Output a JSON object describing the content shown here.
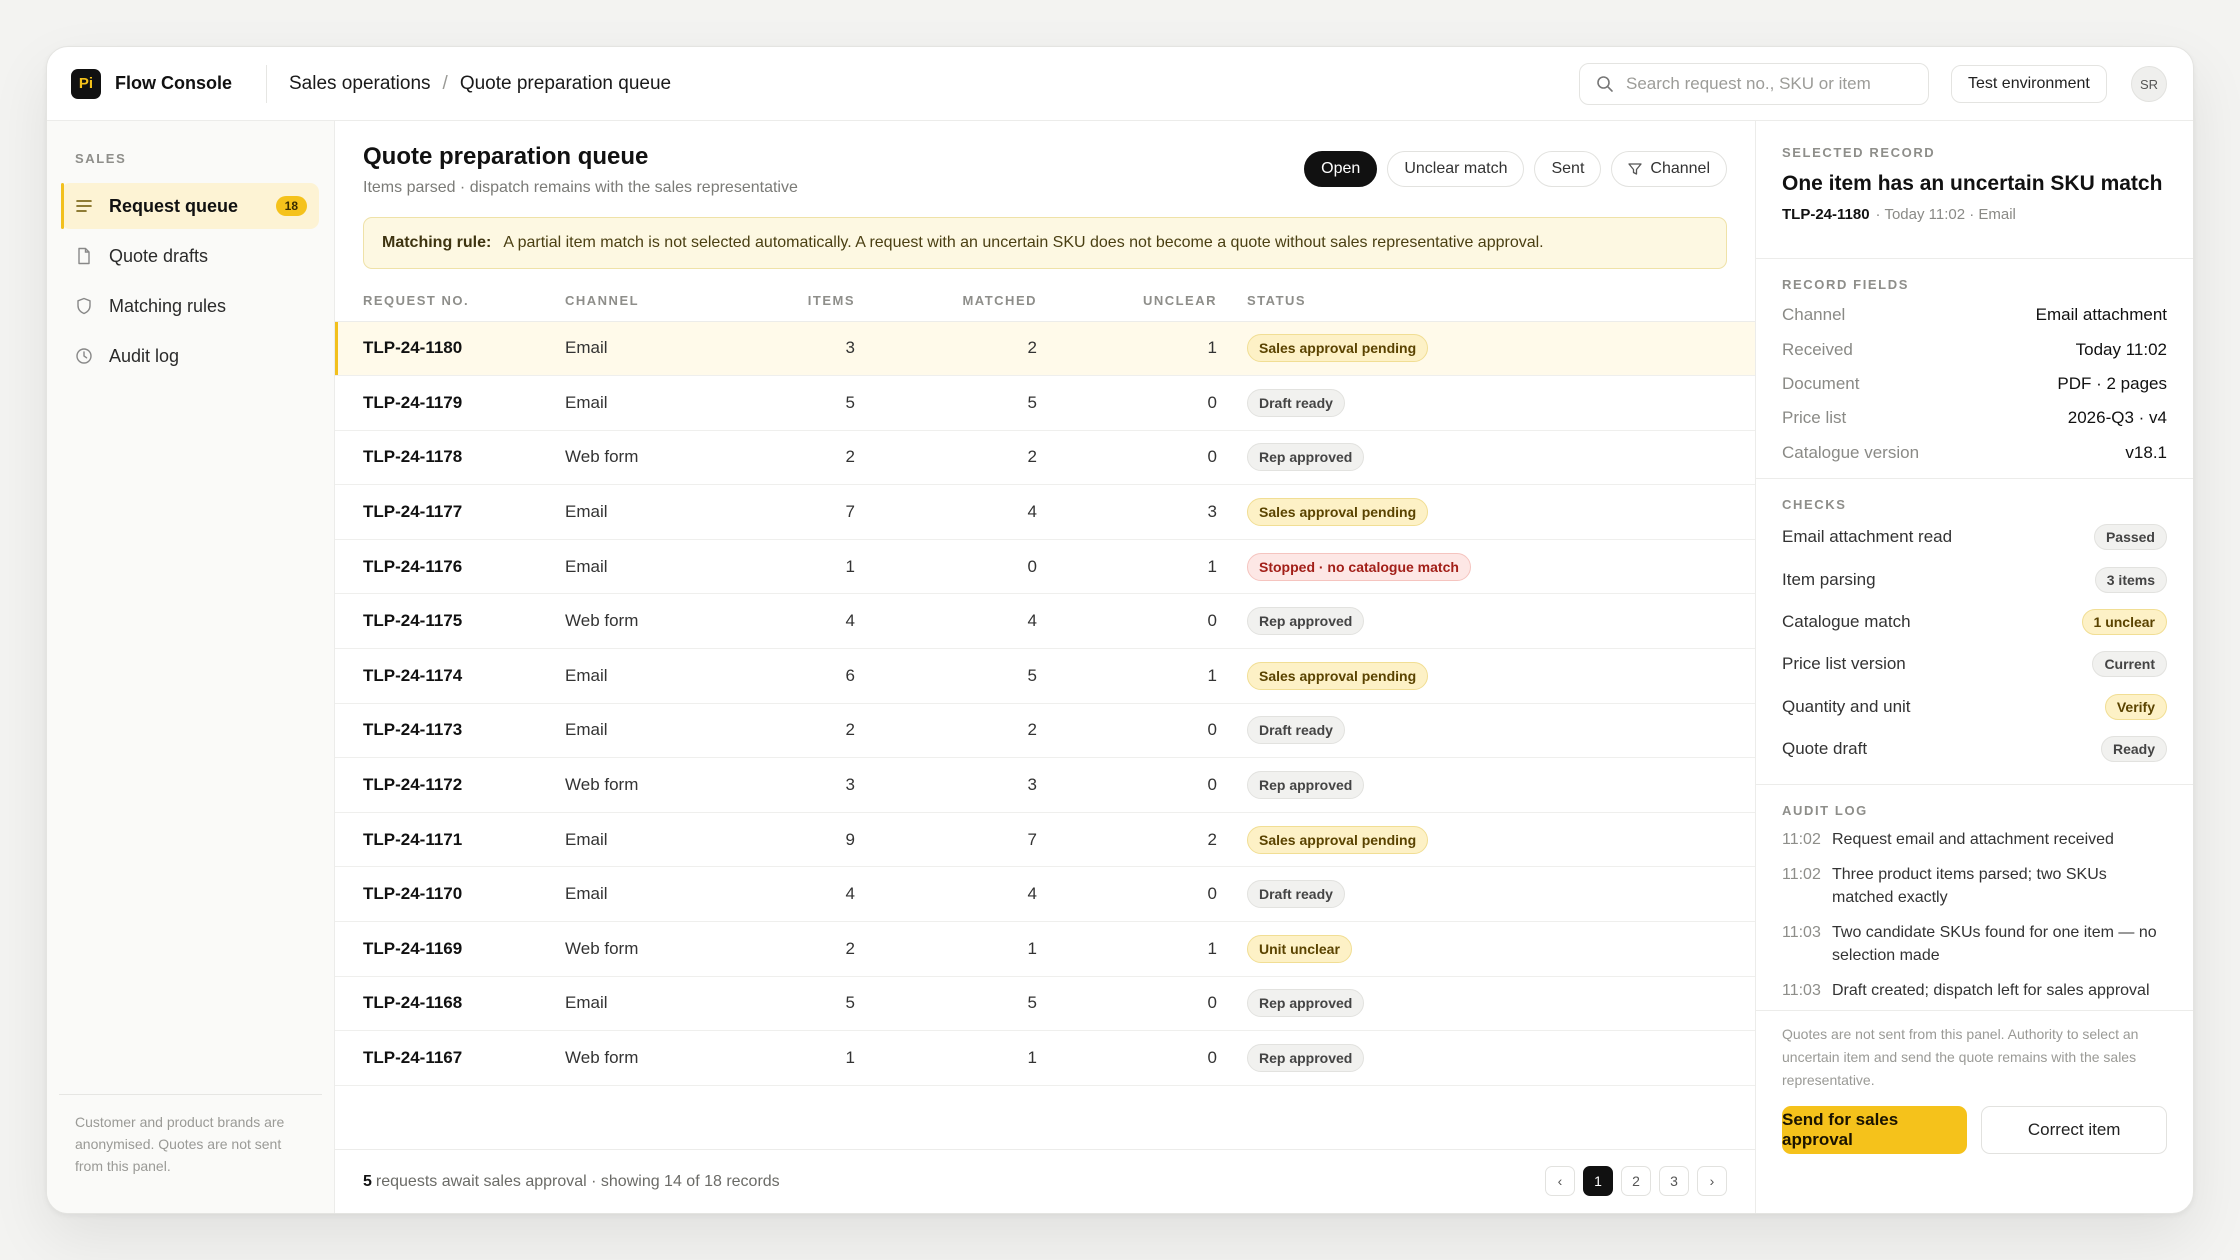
{
  "app": {
    "logo": "Pi",
    "name": "Flow Console"
  },
  "breadcrumb": [
    "Sales operations",
    "Quote preparation queue"
  ],
  "search": {
    "placeholder": "Search request no., SKU or item",
    "icon": "search-icon"
  },
  "environment": "Test environment",
  "user_initials": "SR",
  "sidebar": {
    "heading": "SALES",
    "items": [
      {
        "label": "Request queue",
        "icon": "list-icon",
        "badge": "18",
        "active": true
      },
      {
        "label": "Quote drafts",
        "icon": "document-icon"
      },
      {
        "label": "Matching rules",
        "icon": "shield-icon"
      },
      {
        "label": "Audit log",
        "icon": "clock-icon"
      }
    ],
    "footer": "Customer and product brands are anonymised. Quotes are not sent from this panel."
  },
  "main": {
    "title": "Quote preparation queue",
    "subtitle": "Items parsed · dispatch remains with the sales representative",
    "filters": [
      {
        "label": "Open",
        "active": true
      },
      {
        "label": "Unclear match"
      },
      {
        "label": "Sent"
      },
      {
        "label": "Channel",
        "icon": "filter-icon"
      }
    ],
    "rule": {
      "label": "Matching rule:",
      "text": "A partial item match is not selected automatically. A request with an uncertain SKU does not become a quote without sales representative approval."
    },
    "columns": [
      "REQUEST NO.",
      "CHANNEL",
      "ITEMS",
      "MATCHED",
      "UNCLEAR",
      "STATUS"
    ],
    "rows": [
      {
        "id": "TLP-24-1180",
        "channel": "Email",
        "items": "3",
        "matched": "2",
        "unclear": "1",
        "status": "Sales approval pending",
        "tone": "amber",
        "selected": true
      },
      {
        "id": "TLP-24-1179",
        "channel": "Email",
        "items": "5",
        "matched": "5",
        "unclear": "0",
        "status": "Draft ready",
        "tone": "gray"
      },
      {
        "id": "TLP-24-1178",
        "channel": "Web form",
        "items": "2",
        "matched": "2",
        "unclear": "0",
        "status": "Rep approved",
        "tone": "gray"
      },
      {
        "id": "TLP-24-1177",
        "channel": "Email",
        "items": "7",
        "matched": "4",
        "unclear": "3",
        "status": "Sales approval pending",
        "tone": "amber"
      },
      {
        "id": "TLP-24-1176",
        "channel": "Email",
        "items": "1",
        "matched": "0",
        "unclear": "1",
        "status": "Stopped · no catalogue match",
        "tone": "red"
      },
      {
        "id": "TLP-24-1175",
        "channel": "Web form",
        "items": "4",
        "matched": "4",
        "unclear": "0",
        "status": "Rep approved",
        "tone": "gray"
      },
      {
        "id": "TLP-24-1174",
        "channel": "Email",
        "items": "6",
        "matched": "5",
        "unclear": "1",
        "status": "Sales approval pending",
        "tone": "amber"
      },
      {
        "id": "TLP-24-1173",
        "channel": "Email",
        "items": "2",
        "matched": "2",
        "unclear": "0",
        "status": "Draft ready",
        "tone": "gray"
      },
      {
        "id": "TLP-24-1172",
        "channel": "Web form",
        "items": "3",
        "matched": "3",
        "unclear": "0",
        "status": "Rep approved",
        "tone": "gray"
      },
      {
        "id": "TLP-24-1171",
        "channel": "Email",
        "items": "9",
        "matched": "7",
        "unclear": "2",
        "status": "Sales approval pending",
        "tone": "amber"
      },
      {
        "id": "TLP-24-1170",
        "channel": "Email",
        "items": "4",
        "matched": "4",
        "unclear": "0",
        "status": "Draft ready",
        "tone": "gray"
      },
      {
        "id": "TLP-24-1169",
        "channel": "Web form",
        "items": "2",
        "matched": "1",
        "unclear": "1",
        "status": "Unit unclear",
        "tone": "amber"
      },
      {
        "id": "TLP-24-1168",
        "channel": "Email",
        "items": "5",
        "matched": "5",
        "unclear": "0",
        "status": "Rep approved",
        "tone": "gray"
      },
      {
        "id": "TLP-24-1167",
        "channel": "Web form",
        "items": "1",
        "matched": "1",
        "unclear": "0",
        "status": "Rep approved",
        "tone": "gray"
      }
    ],
    "footer": {
      "count": "5",
      "text": "requests await sales approval · showing 14 of 18 records"
    },
    "pager": {
      "prev": "‹",
      "pages": [
        "1",
        "2",
        "3"
      ],
      "current": "1",
      "next": "›"
    }
  },
  "detail": {
    "caption": "SELECTED RECORD",
    "title": "One item has an uncertain SKU match",
    "id": "TLP-24-1180",
    "meta": "·  Today 11:02 · Email",
    "fields_caption": "RECORD FIELDS",
    "fields": [
      {
        "k": "Channel",
        "v": "Email attachment"
      },
      {
        "k": "Received",
        "v": "Today 11:02"
      },
      {
        "k": "Document",
        "v": "PDF · 2 pages"
      },
      {
        "k": "Price list",
        "v": "2026-Q3 · v4"
      },
      {
        "k": "Catalogue version",
        "v": "v18.1"
      }
    ],
    "checks_caption": "CHECKS",
    "checks": [
      {
        "k": "Email attachment read",
        "v": "Passed",
        "tone": "gray"
      },
      {
        "k": "Item parsing",
        "v": "3 items",
        "tone": "gray"
      },
      {
        "k": "Catalogue match",
        "v": "1 unclear",
        "tone": "amber"
      },
      {
        "k": "Price list version",
        "v": "Current",
        "tone": "gray"
      },
      {
        "k": "Quantity and unit",
        "v": "Verify",
        "tone": "amber"
      },
      {
        "k": "Quote draft",
        "v": "Ready",
        "tone": "gray"
      }
    ],
    "audit_caption": "AUDIT LOG",
    "audit": [
      {
        "t": "11:02",
        "text": "Request email and attachment received"
      },
      {
        "t": "11:02",
        "text": "Three product items parsed; two SKUs matched exactly"
      },
      {
        "t": "11:03",
        "text": "Two candidate SKUs found for one item — no selection made"
      },
      {
        "t": "11:03",
        "text": "Draft created; dispatch left for sales approval"
      }
    ],
    "note": "Quotes are not sent from this panel. Authority to select an uncertain item and send the quote remains with the sales representative.",
    "primary": "Send for sales approval",
    "secondary": "Correct item"
  },
  "colors": {
    "accent": "#f5c21b",
    "amber_bg": "#fdf1c6",
    "red_bg": "#fde7e5",
    "selected_row": "#fffaea"
  }
}
